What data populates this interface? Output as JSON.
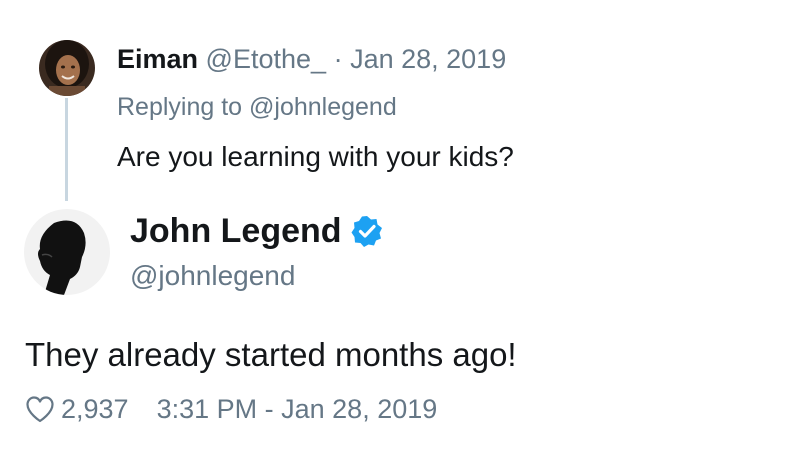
{
  "reply": {
    "name": "Eiman",
    "handle": "@Etothe_",
    "separator": "·",
    "date": "Jan 28, 2019",
    "replying_to": "Replying to @johnlegend",
    "text": "Are you learning with your kids?",
    "avatar_icon": "user-avatar-icon"
  },
  "tweet": {
    "name": "John Legend",
    "handle": "@johnlegend",
    "verified_icon": "verified-badge-icon",
    "text": "They already started months ago!",
    "likes": "2,937",
    "like_icon": "heart-outline-icon",
    "timestamp": "3:31 PM - Jan 28, 2019",
    "avatar_icon": "user-avatar-icon"
  },
  "colors": {
    "verified": "#1da1f2",
    "secondary_text": "#657786",
    "primary_text": "#14171a",
    "thread_line": "#c8d6e0"
  }
}
